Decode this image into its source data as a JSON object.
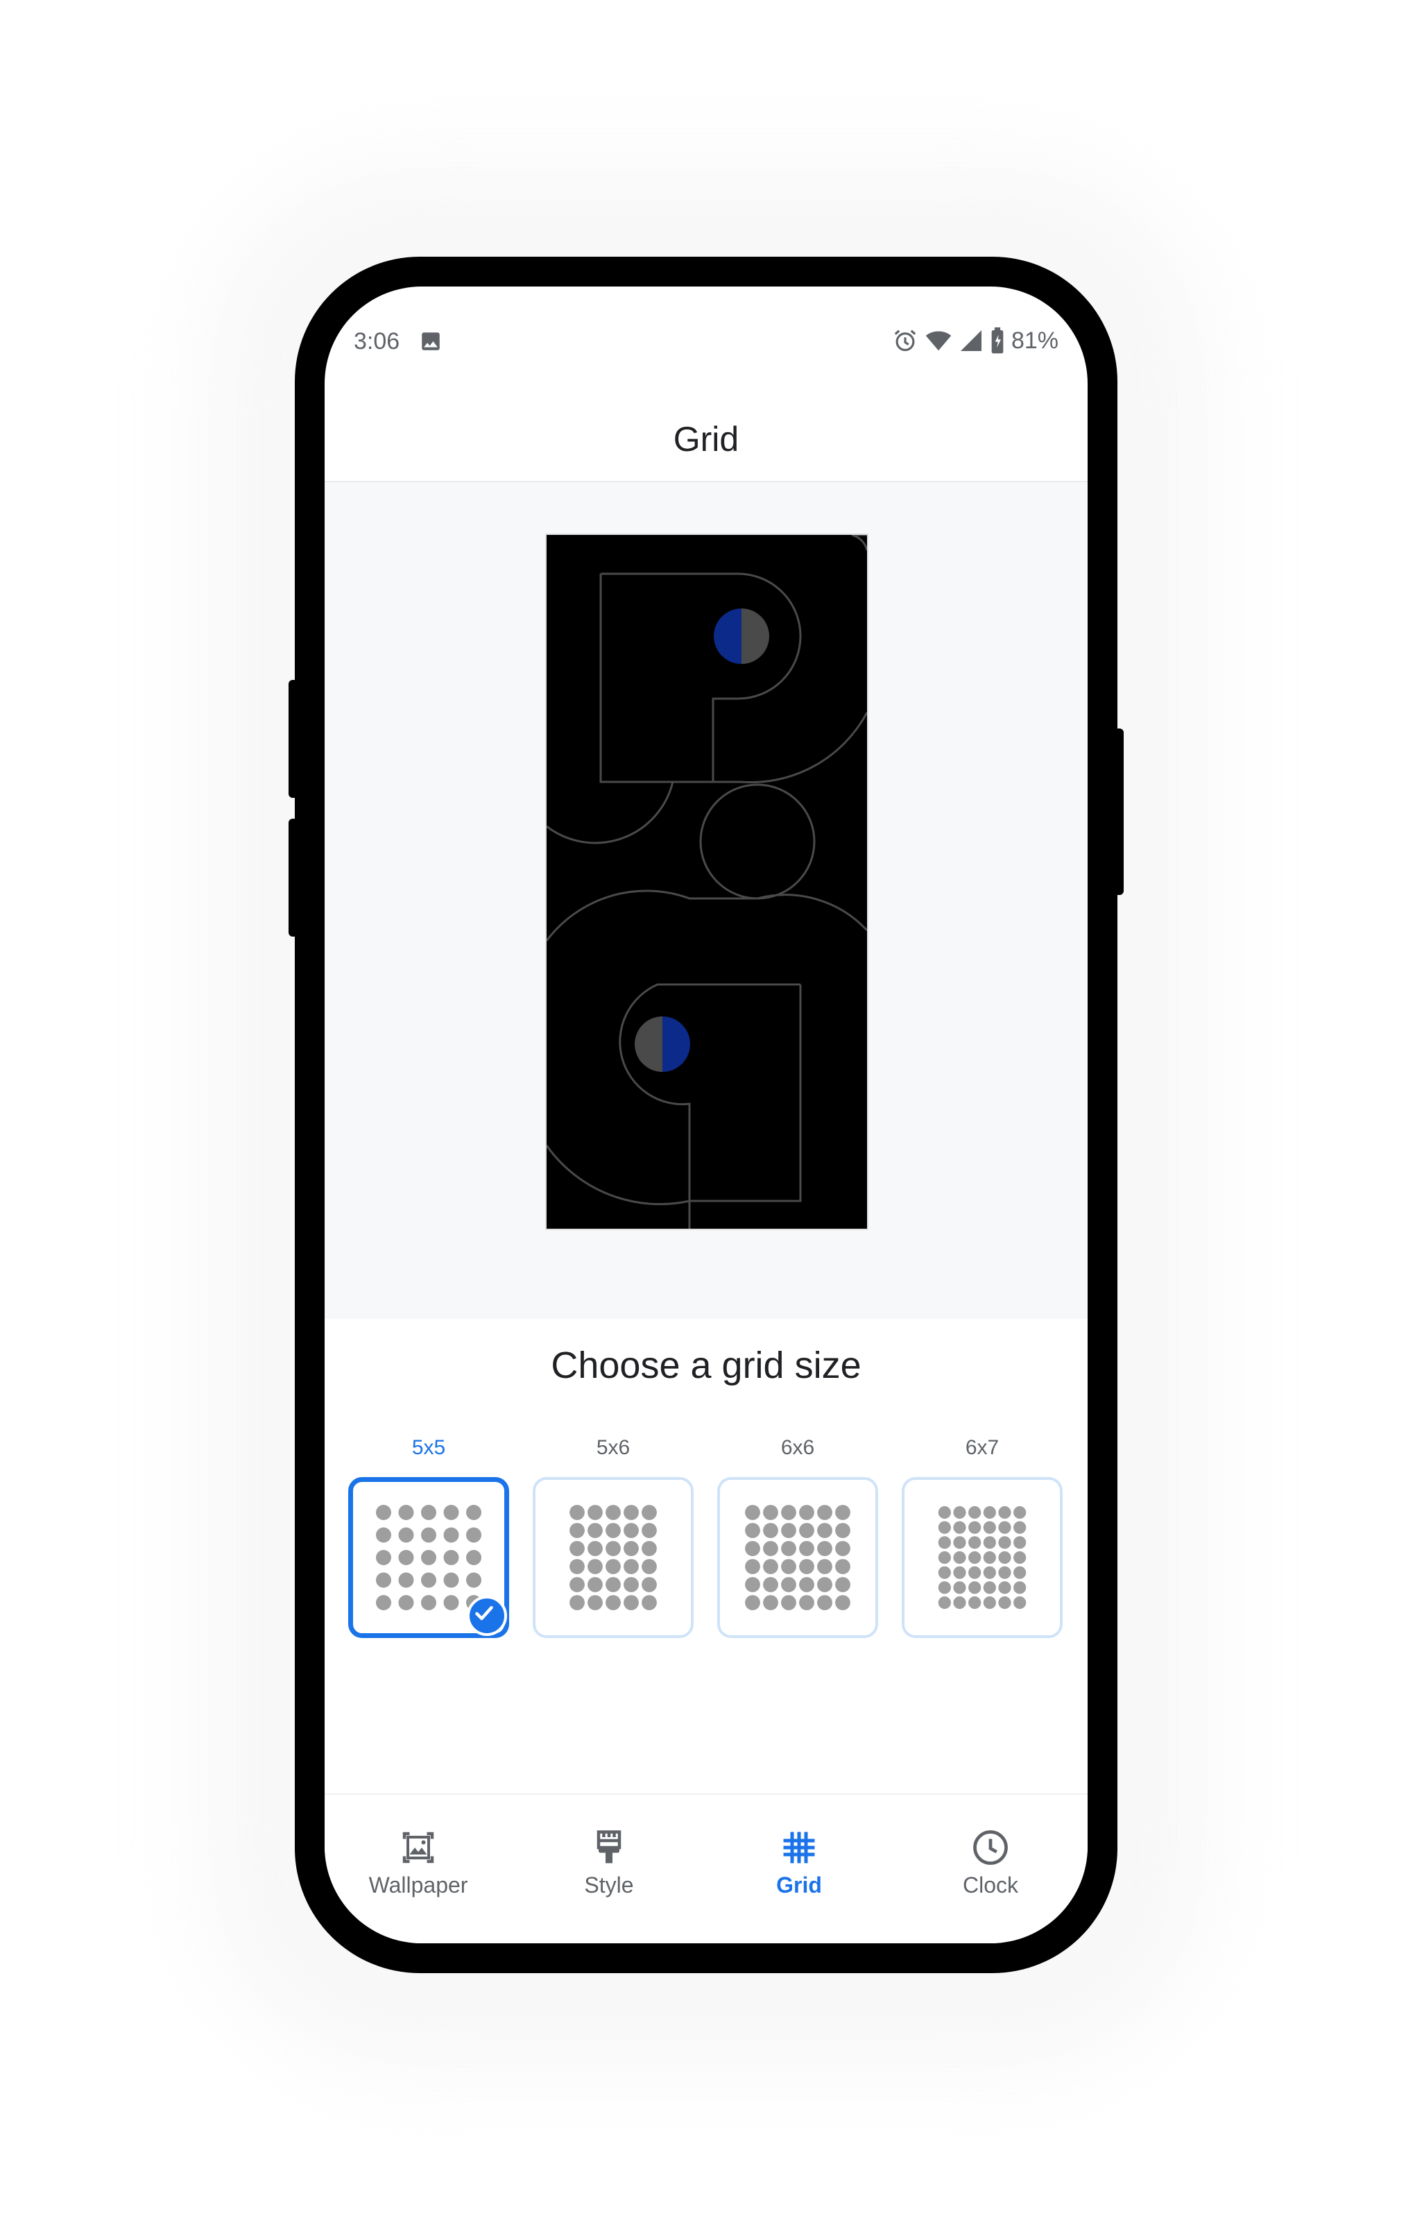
{
  "status_bar": {
    "time": "3:06",
    "battery": "81%",
    "icons": [
      "image-icon",
      "alarm-icon",
      "wifi-icon",
      "signal-icon",
      "battery-icon"
    ]
  },
  "app_bar": {
    "title": "Grid"
  },
  "section": {
    "title": "Choose a grid size"
  },
  "grid_options": [
    {
      "label": "5x5",
      "cols": 5,
      "rows": 5,
      "selected": true
    },
    {
      "label": "5x6",
      "cols": 5,
      "rows": 6,
      "selected": false
    },
    {
      "label": "6x6",
      "cols": 6,
      "rows": 6,
      "selected": false
    },
    {
      "label": "6x7",
      "cols": 6,
      "rows": 7,
      "selected": false
    }
  ],
  "bottom_nav": [
    {
      "label": "Wallpaper",
      "icon": "wallpaper-icon",
      "active": false
    },
    {
      "label": "Style",
      "icon": "brush-icon",
      "active": false
    },
    {
      "label": "Grid",
      "icon": "grid-icon",
      "active": true
    },
    {
      "label": "Clock",
      "icon": "clock-icon",
      "active": false
    }
  ],
  "colors": {
    "accent": "#1a73e8",
    "text_primary": "#202124",
    "text_secondary": "#5f6368",
    "preview_background": "#f7f8fa",
    "wallpaper_blue": "#0b2a8a",
    "wallpaper_grey": "#4a4a4a"
  }
}
